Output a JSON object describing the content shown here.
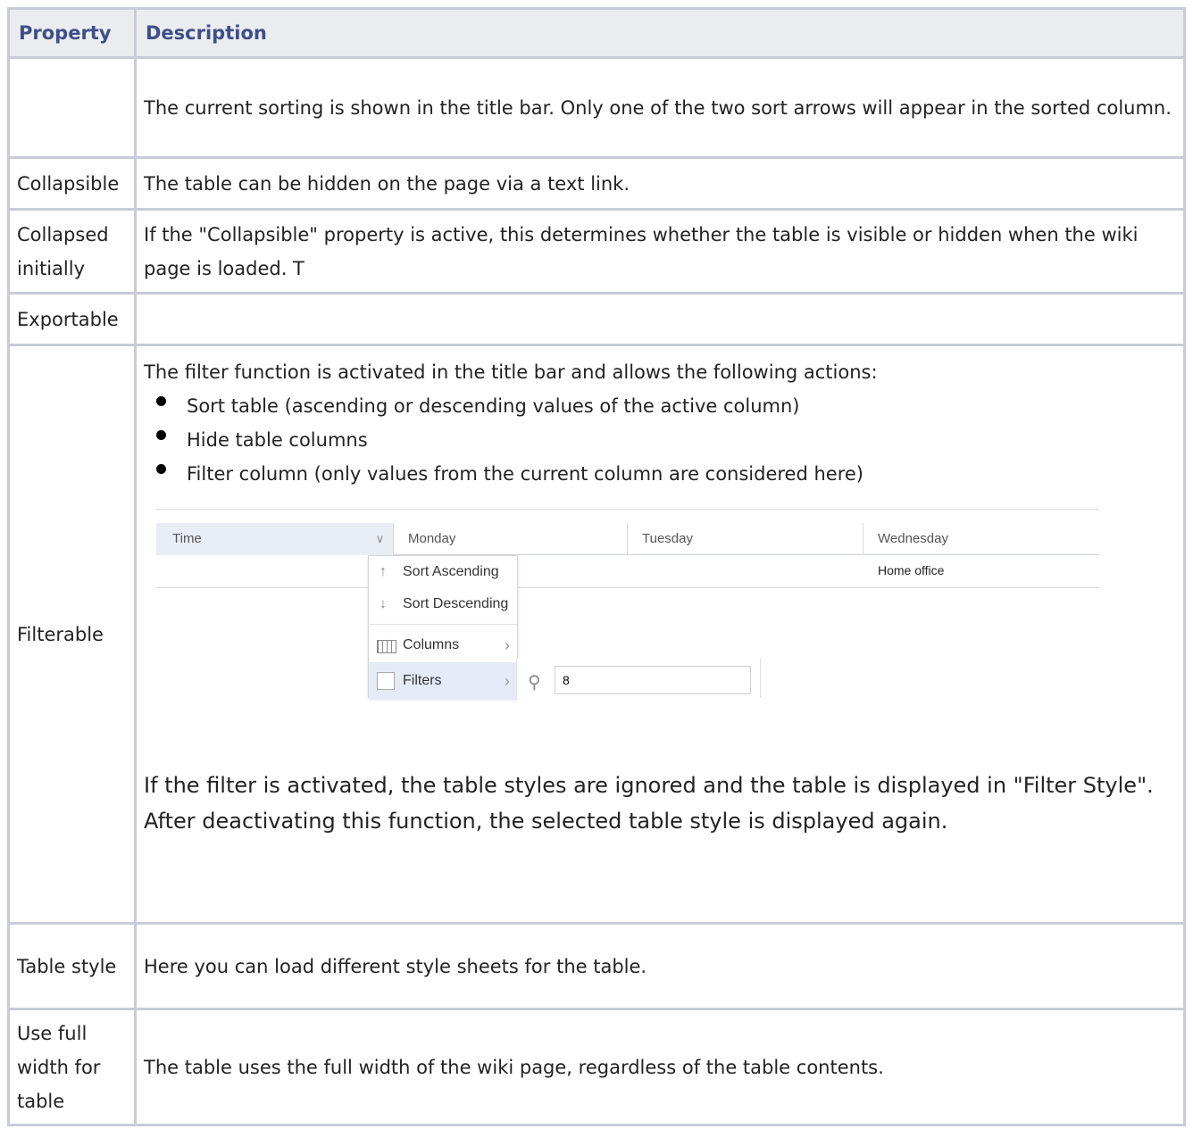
{
  "table": {
    "headers": {
      "property": "Property",
      "description": "Description"
    },
    "rows": [
      {
        "property": "",
        "description": "The current sorting is shown in the title bar. Only one of the two sort arrows will appear in the sorted column."
      },
      {
        "property": "Collapsible",
        "description": "The table can be hidden on the page via a text link."
      },
      {
        "property": "Collapsed initially",
        "description": "If the \"Collapsible\" property is active, this determines whether the table is visible or hidden when the wiki page is loaded. T"
      },
      {
        "property": "Exportable",
        "description": ""
      },
      {
        "property": "Filterable",
        "intro": "The filter function is activated in the title bar and allows the following actions:",
        "bullets": [
          "Sort table (ascending or descending values of the active column)",
          "Hide table columns",
          "Filter column (only values from the current column are considered here)"
        ],
        "note": "If the filter is activated, the table styles are ignored and the table is displayed in \"Filter Style\". After deactivating this function, the selected table style is displayed again."
      },
      {
        "property": "Table style",
        "description": "Here you can load different style sheets for the table."
      },
      {
        "property": "Use full width for table",
        "description": "The table uses the full width of the wiki page, regardless of the table contents."
      }
    ]
  },
  "screenshot": {
    "columns": [
      "Time",
      "Monday",
      "Tuesday",
      "Wednesday"
    ],
    "cell_value": "Home office",
    "menu": {
      "sort_asc": "Sort Ascending",
      "sort_desc": "Sort Descending",
      "columns": "Columns",
      "filters": "Filters"
    },
    "filter_value": "8"
  }
}
